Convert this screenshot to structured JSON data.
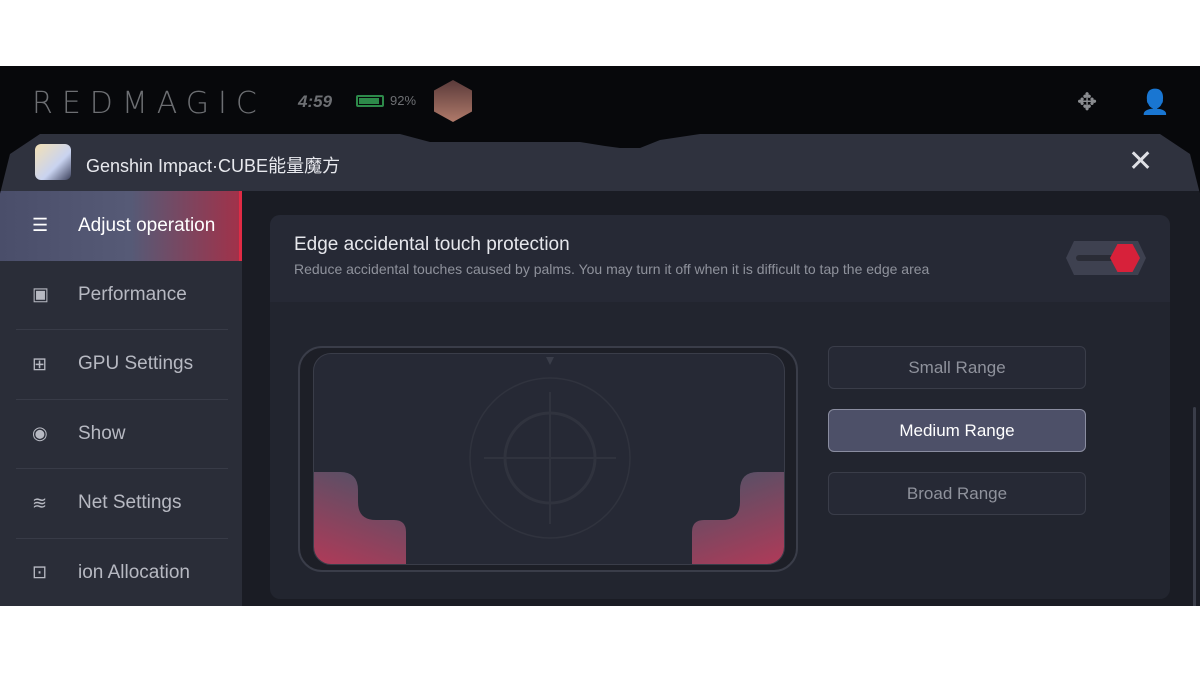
{
  "statusbar": {
    "brand": "REDMAGIC",
    "time": "4:59",
    "battery": "92%",
    "battery_level": 0.92,
    "battery_color": "#2d8a4a"
  },
  "app": {
    "title": "Genshin Impact·CUBE能量魔方"
  },
  "sidebar": {
    "items": [
      {
        "label": "Adjust operation",
        "icon": "sliders-icon",
        "active": true
      },
      {
        "label": "Performance",
        "icon": "chip-icon"
      },
      {
        "label": "GPU Settings",
        "icon": "gpu-icon"
      },
      {
        "label": "Show",
        "icon": "eye-icon"
      },
      {
        "label": "Net Settings",
        "icon": "wifi-icon"
      },
      {
        "label": "ion Allocation",
        "icon": "apps-icon"
      }
    ]
  },
  "edge": {
    "title": "Edge accidental touch protection",
    "subtitle": "Reduce accidental touches caused by palms. You may turn it off when it is difficult to tap the edge area",
    "enabled": true,
    "accent": "#d7213a"
  },
  "ranges": [
    {
      "label": "Small Range"
    },
    {
      "label": "Medium Range",
      "selected": true
    },
    {
      "label": "Broad Range"
    }
  ]
}
